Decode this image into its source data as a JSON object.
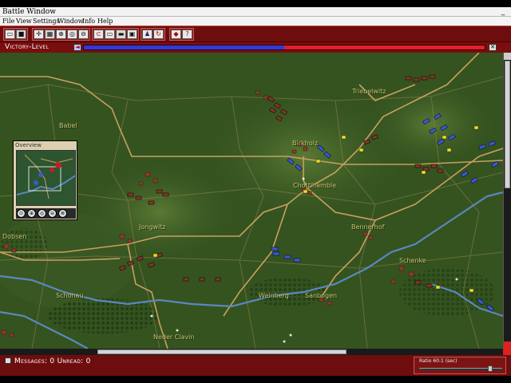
{
  "window": {
    "title": "Battle Window",
    "minimize_glyph": "_"
  },
  "menu": {
    "items": [
      "File",
      "View",
      "Settings",
      "Window",
      "Info",
      "Help"
    ]
  },
  "toolbar": {
    "groups": [
      {
        "icons": [
          "save-icon",
          "disk-icon"
        ]
      },
      {
        "icons": [
          "move-icon",
          "terrain-icon",
          "zoom-in-icon",
          "zoom-icon",
          "zoom-out-icon"
        ]
      },
      {
        "icons": [
          "unit-icon",
          "map-view-icon",
          "panel-icon",
          "screen-icon"
        ]
      },
      {
        "icons": [
          "formation-icon",
          "rotate-icon"
        ]
      },
      {
        "icons": [
          "target-icon",
          "help-icon"
        ]
      }
    ]
  },
  "victory": {
    "label": "Victory-Level",
    "blue_fraction": 0.5
  },
  "map": {
    "towns": [
      "Triebelwitz",
      "Babel",
      "Birkholz",
      "Chottihamble",
      "Dobsen",
      "Jongwitz",
      "Bennerhof",
      "Schenke",
      "Schonau",
      "Weinberg",
      "Sanbogen",
      "Neder Clavin"
    ]
  },
  "overview": {
    "title": "Overview"
  },
  "status": {
    "messages_label": "Messages: 0 Unread: 0",
    "ratio_label": "Ratio 60:1 (sec)"
  },
  "colors": {
    "frame": "#6e0d0d",
    "blue_side": "#2c3cd8",
    "red_side": "#e0202a",
    "terrain": "#2f4f1e",
    "road": "#c9a060",
    "river": "#5a88c0"
  }
}
